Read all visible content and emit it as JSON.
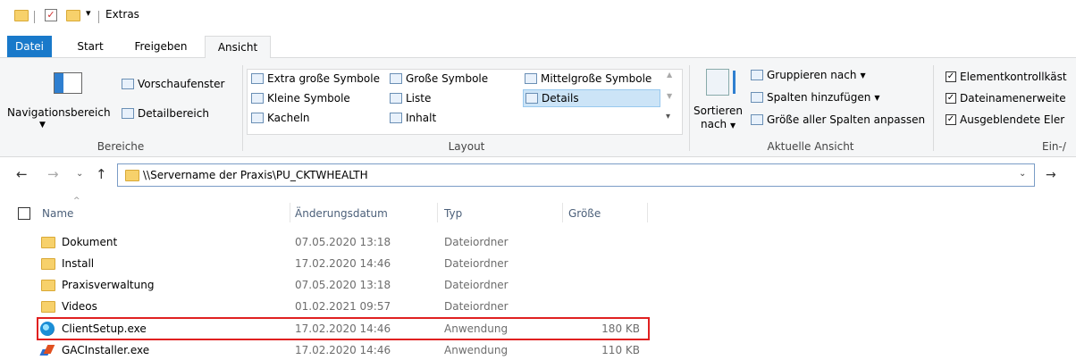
{
  "window": {
    "title": "Extras"
  },
  "tabs": [
    {
      "label": "Datei"
    },
    {
      "label": "Start"
    },
    {
      "label": "Freigeben"
    },
    {
      "label": "Ansicht"
    }
  ],
  "ribbon": {
    "bereiche": {
      "label": "Bereiche",
      "navigationsbereich": "Navigationsbereich",
      "vorschaufenster": "Vorschaufenster",
      "detailbereich": "Detailbereich"
    },
    "layout": {
      "label": "Layout",
      "items": [
        "Extra große Symbole",
        "Große Symbole",
        "Mittelgroße Symbole",
        "Kleine Symbole",
        "Liste",
        "Details",
        "Kacheln",
        "Inhalt"
      ]
    },
    "aktuelle_ansicht": {
      "label": "Aktuelle Ansicht",
      "sortieren": "Sortieren",
      "nach": "nach",
      "gruppieren": "Gruppieren nach",
      "spalten": "Spalten hinzufügen",
      "groesse": "Größe aller Spalten anpassen"
    },
    "ein_aus": {
      "label": "Ein-/",
      "items": [
        "Elementkontrollkäst",
        "Dateinamenerweite",
        "Ausgeblendete Eler"
      ]
    }
  },
  "address": {
    "path": "\\\\Servername der Praxis\\PU_CKTWHEALTH"
  },
  "columns": {
    "name": "Name",
    "date": "Änderungsdatum",
    "type": "Typ",
    "size": "Größe"
  },
  "files": [
    {
      "name": "Dokument",
      "date": "07.05.2020 13:18",
      "type": "Dateiordner",
      "size": "",
      "icon": "folder-icon"
    },
    {
      "name": "Install",
      "date": "17.02.2020 14:46",
      "type": "Dateiordner",
      "size": "",
      "icon": "folder-icon"
    },
    {
      "name": "Praxisverwaltung",
      "date": "07.05.2020 13:18",
      "type": "Dateiordner",
      "size": "",
      "icon": "folder-icon"
    },
    {
      "name": "Videos",
      "date": "01.02.2021 09:57",
      "type": "Dateiordner",
      "size": "",
      "icon": "folder-icon"
    },
    {
      "name": "ClientSetup.exe",
      "date": "17.02.2020 14:46",
      "type": "Anwendung",
      "size": "180 KB",
      "icon": "app-icon"
    },
    {
      "name": "GACInstaller.exe",
      "date": "17.02.2020 14:46",
      "type": "Anwendung",
      "size": "110 KB",
      "icon": "installer-icon"
    }
  ],
  "colors": {
    "accent": "#1979ca",
    "highlight": "#e02020",
    "folder": "#f7d16b"
  }
}
